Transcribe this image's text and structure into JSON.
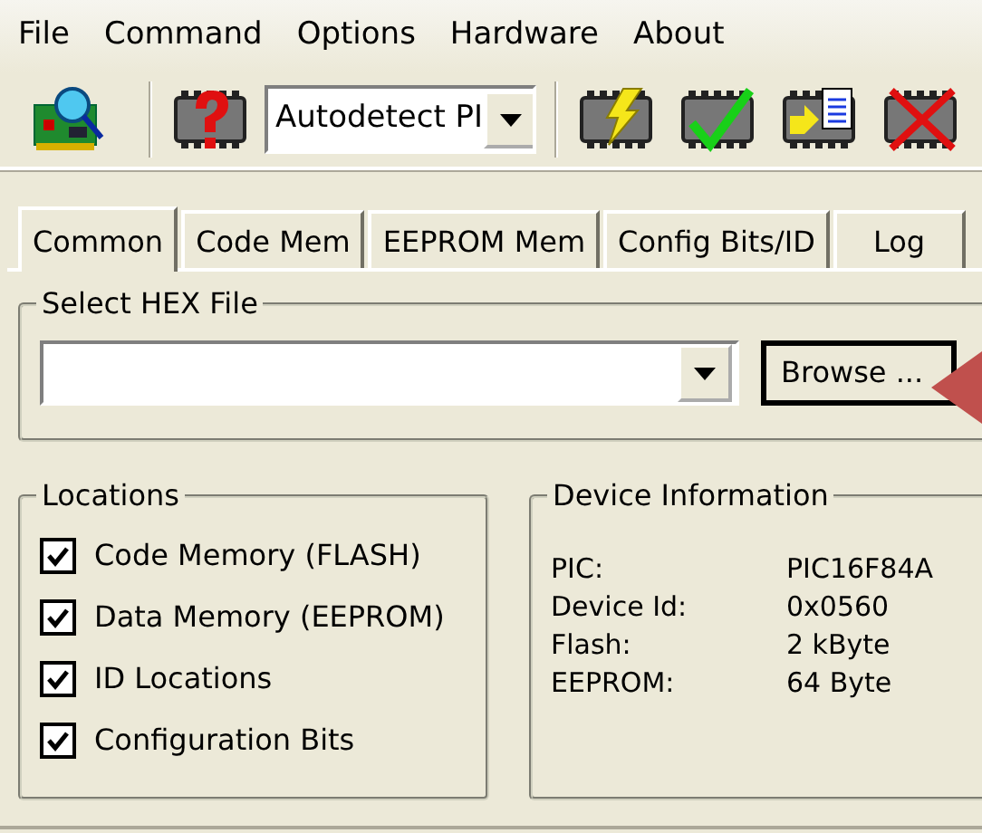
{
  "menu": [
    {
      "label": "File"
    },
    {
      "label": "Command"
    },
    {
      "label": "Options"
    },
    {
      "label": "Hardware"
    },
    {
      "label": "About"
    }
  ],
  "toolbar": {
    "device_select": {
      "value": "Autodetect PI"
    }
  },
  "tabs": [
    {
      "label": "Common",
      "selected": true
    },
    {
      "label": "Code Mem",
      "selected": false
    },
    {
      "label": "EEPROM Mem",
      "selected": false
    },
    {
      "label": "Config Bits/ID",
      "selected": false
    },
    {
      "label": "Log",
      "selected": false
    }
  ],
  "hex_file": {
    "title": "Select HEX File",
    "browse_button": "Browse ..."
  },
  "locations": {
    "title": "Locations",
    "options": [
      {
        "label": "Code Memory (FLASH)",
        "checked": true
      },
      {
        "label": "Data Memory (EEPROM)",
        "checked": true
      },
      {
        "label": "ID Locations",
        "checked": true
      },
      {
        "label": "Configuration Bits",
        "checked": true
      }
    ]
  },
  "device_info": {
    "title": "Device Information",
    "rows": [
      {
        "label": "PIC:",
        "value": "PIC16F84A"
      },
      {
        "label": "Device Id:",
        "value": "0x0560"
      },
      {
        "label": "Flash:",
        "value": "2 kByte"
      },
      {
        "label": "EEPROM:",
        "value": "64 Byte"
      }
    ]
  }
}
